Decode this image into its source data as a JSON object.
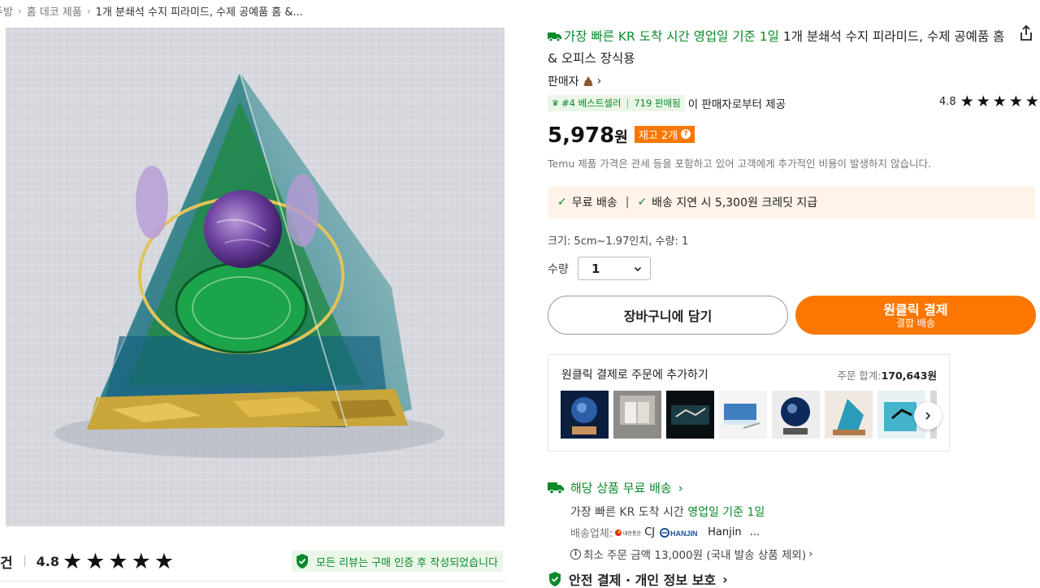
{
  "breadcrumb": {
    "items": [
      "주방",
      "홈 데코 제품",
      "1개 분쇄석 수지 피라미드, 수제 공예품 홈 &..."
    ]
  },
  "product": {
    "shipping_promo": "가장 빠른 KR 도착 시간 영업일 기준 1일",
    "title": "1개 분쇄석 수지 피라미드, 수제 공예품 홈 & 오피스 장식용",
    "seller_label": "판매자",
    "badge_rank": "#4 베스트셀러",
    "badge_sold": "719 판매됨",
    "badge_suffix": "이 판매자로부터 제공",
    "rating": "4.8",
    "price": "5,978",
    "price_unit": "원",
    "stock": "재고 2개",
    "tax_note": "Temu 제품 가격은 관세 등을 포함하고 있어 고객에게 추가적인 비용이 발생하지 않습니다.",
    "free_shipping": "무료 배송",
    "delay_credit": "배송 지연 시 5,300원 크레딧 지급",
    "size_line": "크기: 5cm~1.97인치, 수량: 1",
    "qty_label": "수량",
    "qty_value": "1",
    "add_to_cart": "장바구니에 담기",
    "buy_now": "원클릭 결제",
    "buy_now_sub": "결합 배송"
  },
  "oneclick": {
    "title": "원클릭 결제로 주문에 추가하기",
    "total_label": "주문 합계:",
    "total_value": "170,643원"
  },
  "shipping": {
    "heading": "해당 상품 무료 배송",
    "fastest_prefix": "가장 빠른 KR 도착 시간",
    "fastest_value": "영업일 기준 1일",
    "carrier_label": "배송업체:",
    "carrier_cj": "CJ",
    "carrier_hanjin": "Hanjin",
    "carrier_more": "...",
    "min_order": "최소 주문 금액 13,000원 (국내 발송 상품 제외)",
    "safe_payment": "안전 결제 · 개인 정보 보호"
  },
  "reviews": {
    "label": "건",
    "score": "4.8",
    "verified_note": "모든 리뷰는 구매 인증 후 작성되었습니다"
  },
  "colors": {
    "accent_orange": "#fb7701",
    "accent_green": "#0a8a2a"
  }
}
